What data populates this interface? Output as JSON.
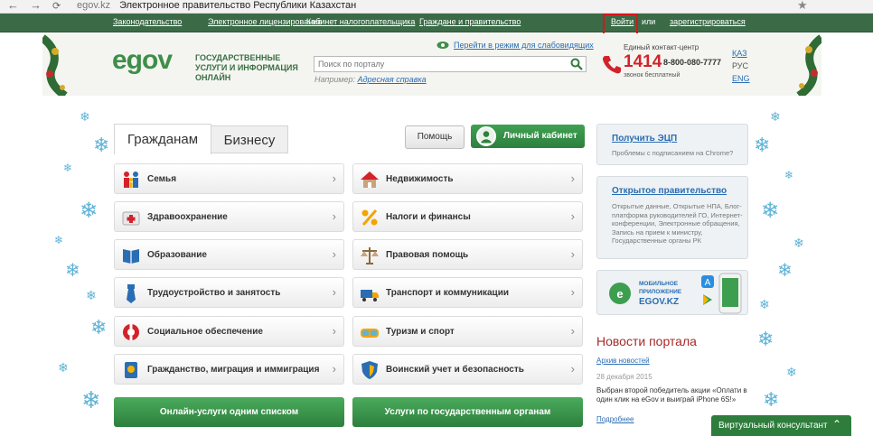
{
  "browser": {
    "url_host": "egov.kz",
    "page_title": "Электронное правительство Республики Казахстан"
  },
  "top_nav": {
    "links": [
      "Законодательство",
      "Электронное лицензирование",
      "Кабинет налогоплательщика",
      "Граждане и правительство"
    ],
    "login": "Войти",
    "or": "или",
    "register": "зарегистрироваться"
  },
  "header": {
    "logo": "egov",
    "logo_sub": "ГОСУДАРСТВЕННЫЕ УСЛУГИ И ИНФОРМАЦИЯ ОНЛАЙН",
    "visually_impaired_link": "Перейти в режим для слабовидящих",
    "search": {
      "placeholder": "Поиск по порталу",
      "example_label": "Например:",
      "example_link": "Адресная справка"
    },
    "contact": {
      "label": "Единый контакт-центр",
      "short_number": "1414",
      "long_number": "8-800-080-7777",
      "note": "звонок бесплатный"
    },
    "languages": [
      "ҚАЗ",
      "РУС",
      "ENG"
    ]
  },
  "tabs": [
    "Гражданам",
    "Бизнесу"
  ],
  "actions": {
    "help": "Помощь",
    "cabinet": "Личный кабинет"
  },
  "categories": {
    "left": [
      "Семья",
      "Здравоохранение",
      "Образование",
      "Трудоустройство и занятость",
      "Социальное обеспечение",
      "Гражданство, миграция и иммиграция"
    ],
    "right": [
      "Недвижимость",
      "Налоги и финансы",
      "Правовая помощь",
      "Транспорт и коммуникации",
      "Туризм и спорт",
      "Воинский учет и безопасность"
    ]
  },
  "bottom_buttons": [
    "Онлайн-услуги одним списком",
    "Услуги по государственным органам"
  ],
  "sidebar": {
    "ecp": {
      "title": "Получить ЭЦП",
      "desc": "Проблемы с подписанием на Chrome?"
    },
    "open_gov": {
      "title": "Открытое правительство",
      "desc": "Открытые данные, Открытые НПА, Блог-платформа руководителей ГО, Интернет-конференции, Электронные обращения, Запись на прием к министру, Государственные органы РК"
    },
    "mobile": {
      "line1": "МОБИЛЬНОЕ",
      "line2": "ПРИЛОЖЕНИЕ",
      "line3": "EGOV.KZ"
    }
  },
  "news": {
    "title": "Новости портала",
    "archive": "Архив новостей",
    "date": "28 декабря 2015",
    "text": "Выбран второй победитель акции «Оплати в один клик на eGov и выиграй iPhone 6S!»",
    "more": "Подробнее"
  },
  "chat": {
    "label": "Виртуальный консультант"
  }
}
